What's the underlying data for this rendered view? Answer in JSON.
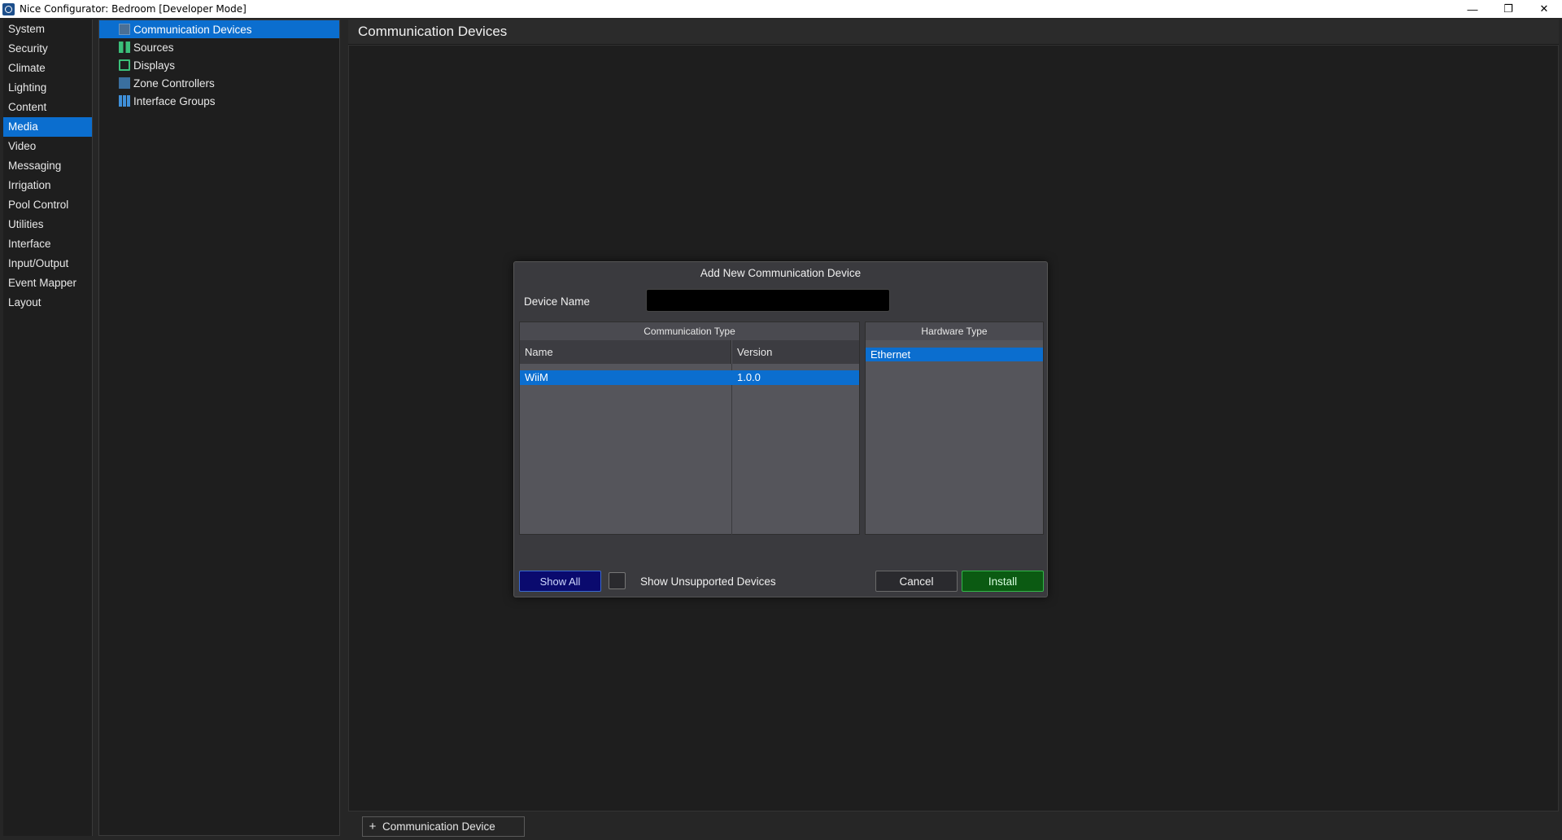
{
  "window": {
    "title": "Nice Configurator: Bedroom [Developer Mode]",
    "minimize_glyph": "—",
    "restore_glyph": "❐",
    "close_glyph": "✕"
  },
  "categories": [
    {
      "label": "System"
    },
    {
      "label": "Security"
    },
    {
      "label": "Climate"
    },
    {
      "label": "Lighting"
    },
    {
      "label": "Content"
    },
    {
      "label": "Media",
      "active": true
    },
    {
      "label": "Video"
    },
    {
      "label": "Messaging"
    },
    {
      "label": "Irrigation"
    },
    {
      "label": "Pool Control"
    },
    {
      "label": "Utilities"
    },
    {
      "label": "Interface"
    },
    {
      "label": "Input/Output"
    },
    {
      "label": "Event Mapper"
    },
    {
      "label": "Layout"
    }
  ],
  "tree": [
    {
      "label": "Communication Devices",
      "icon": "communication-devices-icon",
      "active": true
    },
    {
      "label": "Sources",
      "icon": "sources-icon"
    },
    {
      "label": "Displays",
      "icon": "displays-icon"
    },
    {
      "label": "Zone Controllers",
      "icon": "zone-controllers-icon"
    },
    {
      "label": "Interface Groups",
      "icon": "interface-groups-icon"
    }
  ],
  "main": {
    "title": "Communication Devices",
    "add_button_plus": "+",
    "add_button_label": "Communication Device"
  },
  "dialog": {
    "title": "Add New Communication Device",
    "device_name_label": "Device Name",
    "device_name_value": "",
    "comm_type_title": "Communication Type",
    "col_name": "Name",
    "col_version": "Version",
    "rows": [
      {
        "name": "WiiM",
        "version": "1.0.0",
        "selected": true
      }
    ],
    "hardware_type_title": "Hardware Type",
    "hardware_rows": [
      {
        "label": "Ethernet",
        "selected": true
      }
    ],
    "show_all_label": "Show All",
    "show_unsupported_label": "Show Unsupported Devices",
    "show_unsupported_checked": false,
    "cancel_label": "Cancel",
    "install_label": "Install"
  },
  "colors": {
    "accent": "#0b6ecf",
    "install_green": "#0b5a12",
    "show_all_blue": "#0a0a6e"
  }
}
